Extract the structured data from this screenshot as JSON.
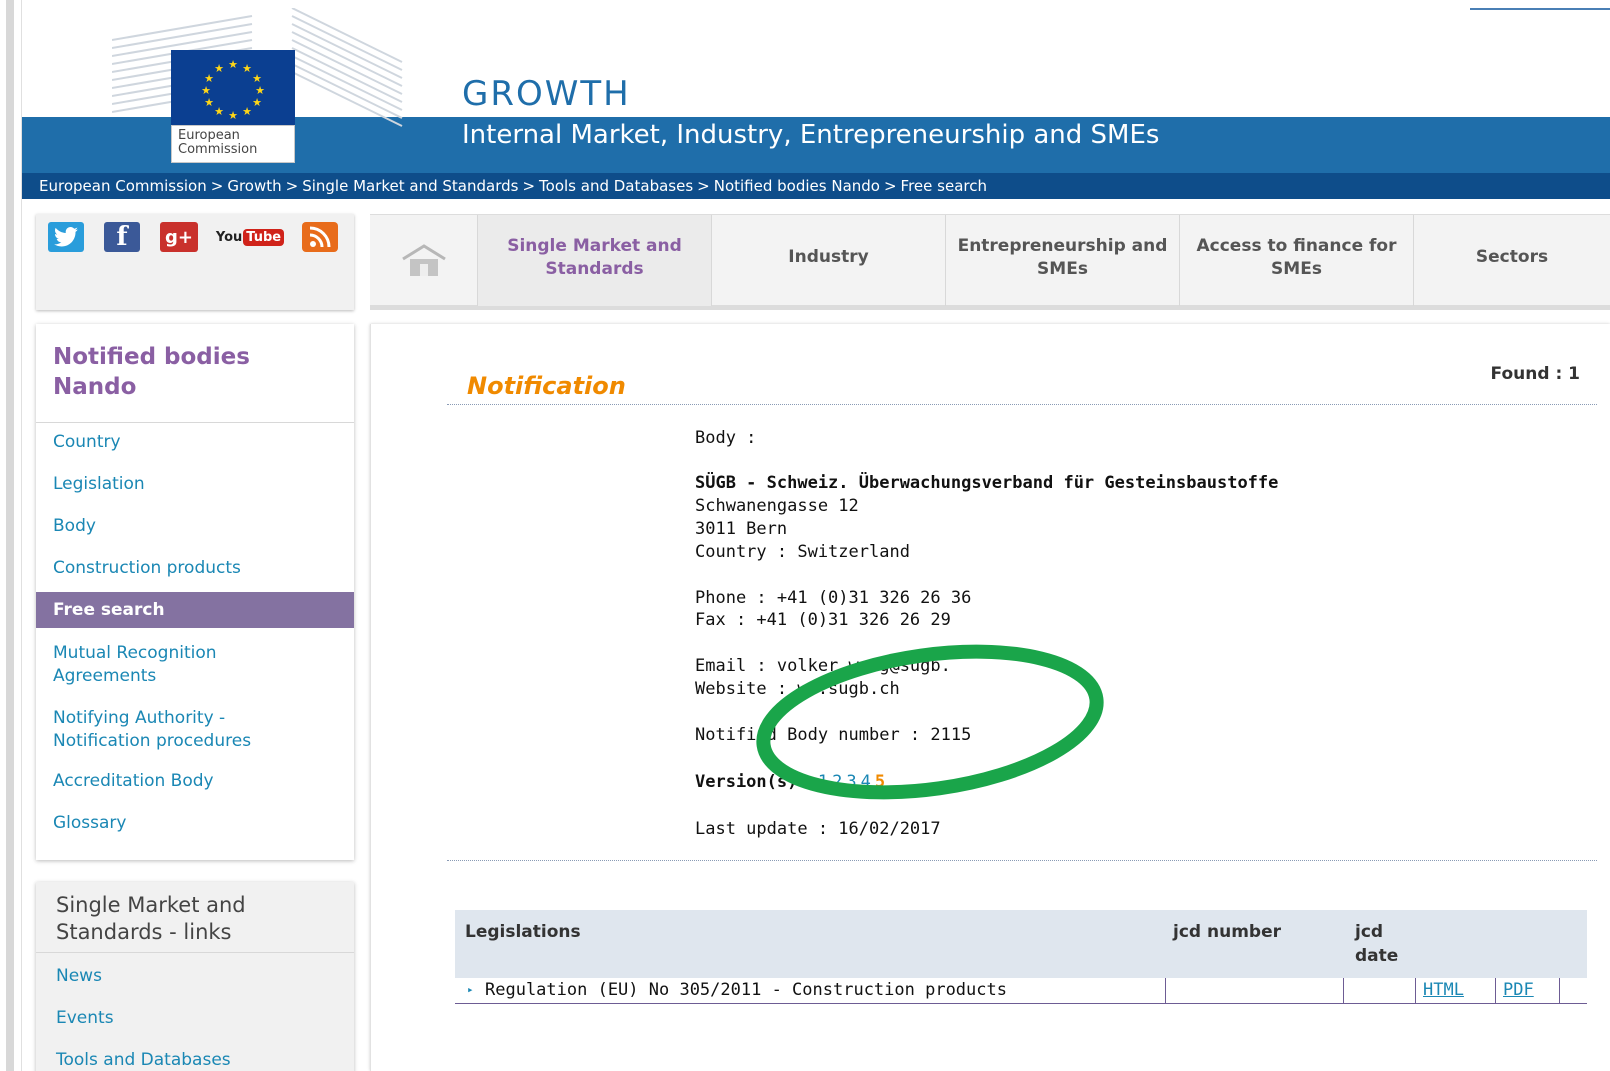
{
  "header": {
    "logo_text": "European Commission",
    "site_title": "GROWTH",
    "site_subtitle": "Internal Market, Industry, Entrepreneurship and SMEs",
    "breadcrumb": [
      "European Commission",
      "Growth",
      "Single Market and Standards",
      "Tools and Databases",
      "Notified bodies Nando",
      "Free search"
    ],
    "breadcrumb_sep": ">"
  },
  "social": {
    "icons": [
      "twitter-icon",
      "facebook-icon",
      "google-plus-icon",
      "youtube-icon",
      "rss-icon"
    ],
    "youtube_you": "You",
    "youtube_tube": "Tube"
  },
  "topnav": {
    "home_icon": "home-icon",
    "tabs": [
      {
        "label": "Single Market and Standards",
        "active": true
      },
      {
        "label": "Industry",
        "active": false
      },
      {
        "label": "Entrepreneurship and SMEs",
        "active": false
      },
      {
        "label": "Access to finance for SMEs",
        "active": false
      },
      {
        "label": "Sectors",
        "active": false
      }
    ]
  },
  "sidemenu": {
    "title": "Notified bodies Nando",
    "items": [
      {
        "label": "Country",
        "active": false
      },
      {
        "label": "Legislation",
        "active": false
      },
      {
        "label": "Body",
        "active": false
      },
      {
        "label": "Construction products",
        "active": false
      },
      {
        "label": "Free search",
        "active": true
      },
      {
        "label": "Mutual Recognition Agreements",
        "active": false
      },
      {
        "label": "Notifying Authority - Notification procedures",
        "active": false
      },
      {
        "label": "Accreditation Body",
        "active": false
      },
      {
        "label": "Glossary",
        "active": false
      }
    ]
  },
  "links_box": {
    "title": "Single Market and Standards - links",
    "items": [
      "News",
      "Events",
      "Tools and Databases"
    ]
  },
  "notification": {
    "heading": "Notification",
    "found_label": "Found : 1",
    "body_label": "Body :",
    "body_name": "SÜGB - Schweiz. Überwachungsverband für Gesteinsbaustoffe",
    "street": "Schwanengasse 12",
    "city": "3011 Bern",
    "country_line": "Country : Switzerland",
    "phone_line": "Phone : +41 (0)31 326 26 36",
    "fax_line": "Fax : +41 (0)31 326 26 29",
    "email_line": "Email : volker.we   g@sugb.",
    "website_line": "Website :   ww.sugb.ch",
    "nb_number_line": "Notified Body number : 2115",
    "versions_label": "Version(s)",
    "version_links": [
      "1",
      "2",
      "3",
      "4"
    ],
    "version_current": "5",
    "last_update_line": "Last update : 16/02/2017"
  },
  "legislations_table": {
    "headers": {
      "legislation": "Legislations",
      "jcd_number": "jcd number",
      "jcd_date": "jcd date"
    },
    "rows": [
      {
        "bullet": "▸",
        "legislation": "Regulation (EU) No 305/2011 - Construction products",
        "jcd_number": "",
        "jcd_date": "",
        "html_link": "HTML",
        "pdf_link": "PDF"
      }
    ]
  },
  "colors": {
    "blue_band": "#1f6eaa",
    "breadcrumb_band": "#0e4d8a",
    "purple_accent": "#8a5fa3",
    "orange_heading": "#f08a00",
    "link_blue": "#1a87b4",
    "highlight_green": "#1aa54a"
  }
}
